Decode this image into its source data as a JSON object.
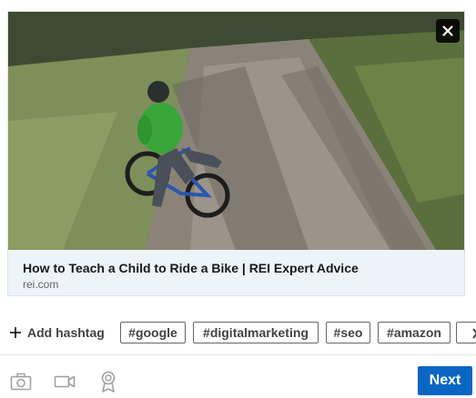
{
  "link_preview": {
    "title": "How to Teach a Child to Ride a Bike | REI Expert Advice",
    "domain": "rei.com",
    "close_icon": "close-icon"
  },
  "hashtag_bar": {
    "add_label": "Add hashtag",
    "add_icon": "plus-icon",
    "suggestions": [
      "#google",
      "#digitalmarketing",
      "#seo",
      "#amazon"
    ]
  },
  "toolbar": {
    "icons": [
      "camera-icon",
      "video-icon",
      "award-icon"
    ],
    "next_label": "Next"
  },
  "colors": {
    "accent": "#0a66c2",
    "preview_background": "#eef3f8"
  }
}
